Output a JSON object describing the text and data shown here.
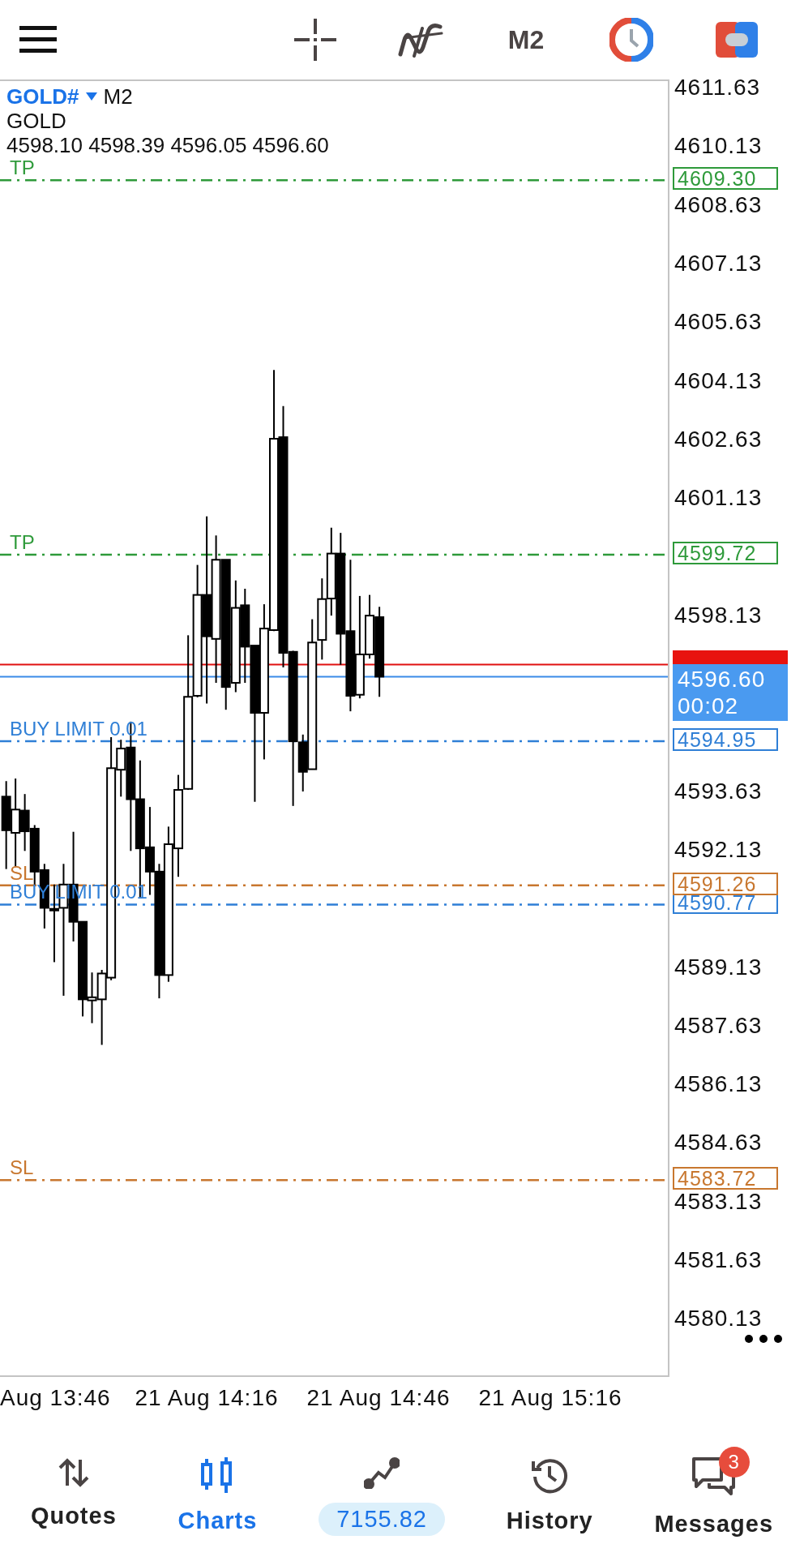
{
  "toolbar": {
    "timeframe": "M2"
  },
  "chart": {
    "symbol": "GOLD#",
    "timeframe": "M2",
    "description": "GOLD",
    "ohlc": "4598.10 4598.39 4596.05 4596.60",
    "levels": [
      {
        "kind": "tp",
        "label": "TP",
        "price": "4609.30"
      },
      {
        "kind": "tp",
        "label": "TP",
        "price": "4599.72"
      },
      {
        "kind": "buy_limit",
        "label": "BUY LIMIT 0.01",
        "price": "4594.95"
      },
      {
        "kind": "sl",
        "label": "SL",
        "price": "4591.26"
      },
      {
        "kind": "buy_limit",
        "label": "BUY LIMIT 0.01",
        "price": "4590.77"
      },
      {
        "kind": "sl",
        "label": "SL",
        "price": "4583.72"
      }
    ],
    "bid": {
      "price": "4596.60",
      "countdown": "00:02"
    },
    "price_ticks": [
      "4611.63",
      "4610.13",
      "4608.63",
      "4607.13",
      "4605.63",
      "4604.13",
      "4602.63",
      "4601.13",
      "4598.13",
      "4593.63",
      "4592.13",
      "4589.13",
      "4587.63",
      "4586.13",
      "4584.63",
      "4583.13",
      "4581.63",
      "4580.13"
    ],
    "time_labels": [
      "Aug 13:46",
      "21 Aug 14:16",
      "21 Aug 14:46",
      "21 Aug 15:16"
    ]
  },
  "nav": [
    {
      "kind": "quotes",
      "label": "Quotes",
      "selected": false
    },
    {
      "kind": "charts",
      "label": "Charts",
      "selected": true
    },
    {
      "kind": "trade",
      "label": "7155.82",
      "selected": false
    },
    {
      "kind": "history",
      "label": "History",
      "selected": false
    },
    {
      "kind": "messages",
      "label": "Messages",
      "selected": false,
      "badge": "3"
    }
  ]
}
